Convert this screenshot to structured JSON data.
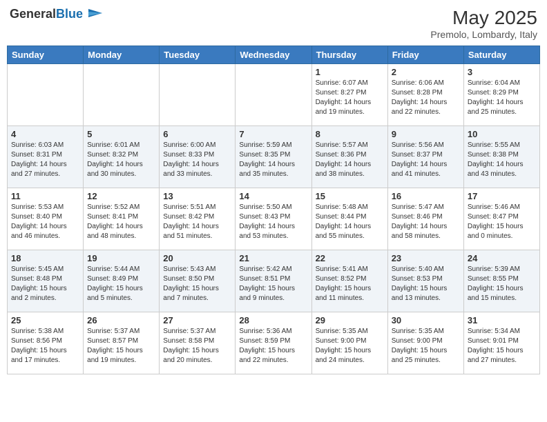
{
  "logo": {
    "text_general": "General",
    "text_blue": "Blue"
  },
  "header": {
    "month_year": "May 2025",
    "location": "Premolo, Lombardy, Italy"
  },
  "days_of_week": [
    "Sunday",
    "Monday",
    "Tuesday",
    "Wednesday",
    "Thursday",
    "Friday",
    "Saturday"
  ],
  "weeks": [
    [
      {
        "day": "",
        "info": ""
      },
      {
        "day": "",
        "info": ""
      },
      {
        "day": "",
        "info": ""
      },
      {
        "day": "",
        "info": ""
      },
      {
        "day": "1",
        "info": "Sunrise: 6:07 AM\nSunset: 8:27 PM\nDaylight: 14 hours\nand 19 minutes."
      },
      {
        "day": "2",
        "info": "Sunrise: 6:06 AM\nSunset: 8:28 PM\nDaylight: 14 hours\nand 22 minutes."
      },
      {
        "day": "3",
        "info": "Sunrise: 6:04 AM\nSunset: 8:29 PM\nDaylight: 14 hours\nand 25 minutes."
      }
    ],
    [
      {
        "day": "4",
        "info": "Sunrise: 6:03 AM\nSunset: 8:31 PM\nDaylight: 14 hours\nand 27 minutes."
      },
      {
        "day": "5",
        "info": "Sunrise: 6:01 AM\nSunset: 8:32 PM\nDaylight: 14 hours\nand 30 minutes."
      },
      {
        "day": "6",
        "info": "Sunrise: 6:00 AM\nSunset: 8:33 PM\nDaylight: 14 hours\nand 33 minutes."
      },
      {
        "day": "7",
        "info": "Sunrise: 5:59 AM\nSunset: 8:35 PM\nDaylight: 14 hours\nand 35 minutes."
      },
      {
        "day": "8",
        "info": "Sunrise: 5:57 AM\nSunset: 8:36 PM\nDaylight: 14 hours\nand 38 minutes."
      },
      {
        "day": "9",
        "info": "Sunrise: 5:56 AM\nSunset: 8:37 PM\nDaylight: 14 hours\nand 41 minutes."
      },
      {
        "day": "10",
        "info": "Sunrise: 5:55 AM\nSunset: 8:38 PM\nDaylight: 14 hours\nand 43 minutes."
      }
    ],
    [
      {
        "day": "11",
        "info": "Sunrise: 5:53 AM\nSunset: 8:40 PM\nDaylight: 14 hours\nand 46 minutes."
      },
      {
        "day": "12",
        "info": "Sunrise: 5:52 AM\nSunset: 8:41 PM\nDaylight: 14 hours\nand 48 minutes."
      },
      {
        "day": "13",
        "info": "Sunrise: 5:51 AM\nSunset: 8:42 PM\nDaylight: 14 hours\nand 51 minutes."
      },
      {
        "day": "14",
        "info": "Sunrise: 5:50 AM\nSunset: 8:43 PM\nDaylight: 14 hours\nand 53 minutes."
      },
      {
        "day": "15",
        "info": "Sunrise: 5:48 AM\nSunset: 8:44 PM\nDaylight: 14 hours\nand 55 minutes."
      },
      {
        "day": "16",
        "info": "Sunrise: 5:47 AM\nSunset: 8:46 PM\nDaylight: 14 hours\nand 58 minutes."
      },
      {
        "day": "17",
        "info": "Sunrise: 5:46 AM\nSunset: 8:47 PM\nDaylight: 15 hours\nand 0 minutes."
      }
    ],
    [
      {
        "day": "18",
        "info": "Sunrise: 5:45 AM\nSunset: 8:48 PM\nDaylight: 15 hours\nand 2 minutes."
      },
      {
        "day": "19",
        "info": "Sunrise: 5:44 AM\nSunset: 8:49 PM\nDaylight: 15 hours\nand 5 minutes."
      },
      {
        "day": "20",
        "info": "Sunrise: 5:43 AM\nSunset: 8:50 PM\nDaylight: 15 hours\nand 7 minutes."
      },
      {
        "day": "21",
        "info": "Sunrise: 5:42 AM\nSunset: 8:51 PM\nDaylight: 15 hours\nand 9 minutes."
      },
      {
        "day": "22",
        "info": "Sunrise: 5:41 AM\nSunset: 8:52 PM\nDaylight: 15 hours\nand 11 minutes."
      },
      {
        "day": "23",
        "info": "Sunrise: 5:40 AM\nSunset: 8:53 PM\nDaylight: 15 hours\nand 13 minutes."
      },
      {
        "day": "24",
        "info": "Sunrise: 5:39 AM\nSunset: 8:55 PM\nDaylight: 15 hours\nand 15 minutes."
      }
    ],
    [
      {
        "day": "25",
        "info": "Sunrise: 5:38 AM\nSunset: 8:56 PM\nDaylight: 15 hours\nand 17 minutes."
      },
      {
        "day": "26",
        "info": "Sunrise: 5:37 AM\nSunset: 8:57 PM\nDaylight: 15 hours\nand 19 minutes."
      },
      {
        "day": "27",
        "info": "Sunrise: 5:37 AM\nSunset: 8:58 PM\nDaylight: 15 hours\nand 20 minutes."
      },
      {
        "day": "28",
        "info": "Sunrise: 5:36 AM\nSunset: 8:59 PM\nDaylight: 15 hours\nand 22 minutes."
      },
      {
        "day": "29",
        "info": "Sunrise: 5:35 AM\nSunset: 9:00 PM\nDaylight: 15 hours\nand 24 minutes."
      },
      {
        "day": "30",
        "info": "Sunrise: 5:35 AM\nSunset: 9:00 PM\nDaylight: 15 hours\nand 25 minutes."
      },
      {
        "day": "31",
        "info": "Sunrise: 5:34 AM\nSunset: 9:01 PM\nDaylight: 15 hours\nand 27 minutes."
      }
    ]
  ]
}
